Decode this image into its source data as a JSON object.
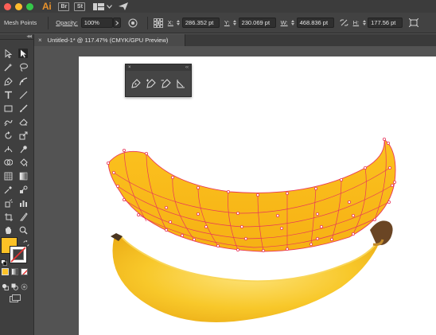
{
  "titlebar": {
    "app_logo": "Ai",
    "bridge_label": "Br",
    "stock_label": "St"
  },
  "controlbar": {
    "selection_label": "Mesh Points",
    "opacity_label": "Opacity:",
    "opacity_value": "100%",
    "x_label": "X:",
    "x_value": "286.352 pt",
    "y_label": "Y:",
    "y_value": "230.069 pt",
    "w_label": "W:",
    "w_value": "468.836 pt",
    "h_label": "H:",
    "h_value": "177.56 pt"
  },
  "document": {
    "tab_title": "Untitled-1* @ 117.47% (CMYK/GPU Preview)",
    "close_glyph": "×"
  },
  "floatpanel": {
    "close_glyph": "×",
    "collapse_glyph": "‹‹",
    "tools": [
      "pen-tool",
      "add-anchor-tool",
      "delete-anchor-tool",
      "anchor-point-tool"
    ]
  },
  "colors": {
    "fill": "#fcc226",
    "stroke": "#ffffff",
    "accent": "#e8922b",
    "mesh_line": "#e8365a"
  }
}
